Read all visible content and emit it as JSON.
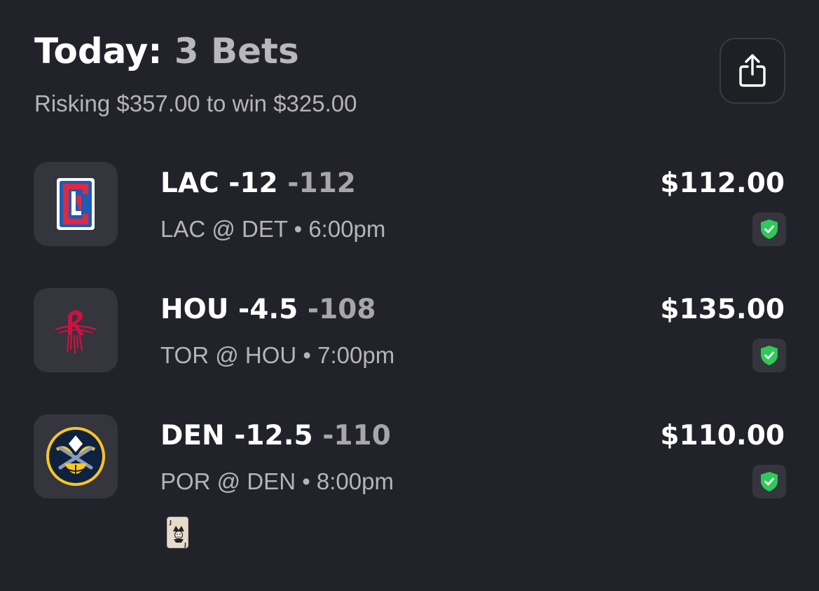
{
  "header": {
    "title_prefix": "Today:",
    "title_count": "3 Bets",
    "subtitle": "Risking $357.00 to win $325.00",
    "share_icon": "share-icon"
  },
  "bets": [
    {
      "pick": "LAC -12",
      "odds": "-112",
      "game": "LAC @ DET • 6:00pm",
      "amount": "$112.00",
      "logo_icon": "clippers-logo",
      "status_icon": "shield-check-icon"
    },
    {
      "pick": "HOU -4.5",
      "odds": "-108",
      "game": "TOR @ HOU • 7:00pm",
      "amount": "$135.00",
      "logo_icon": "rockets-logo",
      "status_icon": "shield-check-icon"
    },
    {
      "pick": "DEN -12.5",
      "odds": "-110",
      "game": "POR @ DEN • 8:00pm",
      "amount": "$110.00",
      "logo_icon": "nuggets-logo",
      "status_icon": "shield-check-icon"
    }
  ],
  "tag": {
    "icon": "joker-card-icon"
  },
  "colors": {
    "background": "#22232a",
    "tile": "#34353d",
    "muted_text": "#b4b4b9",
    "status_green": "#2fc95a",
    "clippers_red": "#e0283f",
    "clippers_blue": "#1d5bb5",
    "rockets_red": "#ce1141",
    "nuggets_navy": "#0e2240",
    "nuggets_gold": "#fec524"
  }
}
